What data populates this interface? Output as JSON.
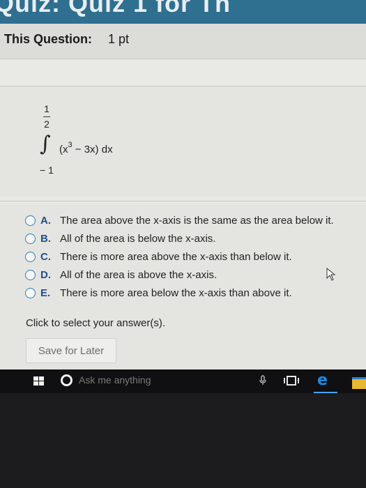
{
  "page": {
    "top_title": "Quiz: Quiz 1 for Th"
  },
  "header": {
    "question_label": "This Question:",
    "points": "1 pt"
  },
  "question": {
    "integral_upper_numerator": "1",
    "integral_upper_denominator": "2",
    "integral_sign": "∫",
    "integrand_open": "(x",
    "integrand_exponent": "3",
    "integrand_rest": " − 3x) dx",
    "integral_lower": "− 1"
  },
  "options": [
    {
      "letter": "A.",
      "text": "The area above the x-axis is the same as the area below it."
    },
    {
      "letter": "B.",
      "text": "All of the area is below the x-axis."
    },
    {
      "letter": "C.",
      "text": "There is more area above the x-axis than below it."
    },
    {
      "letter": "D.",
      "text": "All of the area is above the x-axis."
    },
    {
      "letter": "E.",
      "text": "There is more area below the x-axis than above it."
    }
  ],
  "instruction": "Click to select your answer(s).",
  "save_button": "Save for Later",
  "taskbar": {
    "search_placeholder": "Ask me anything",
    "icons": [
      "windows-start-icon",
      "cortana-icon",
      "microphone-icon",
      "task-view-icon",
      "edge-browser-icon",
      "file-explorer-icon"
    ]
  },
  "colors": {
    "option_letter": "#1f4f8c",
    "radio_border": "#2e7db6",
    "title_strip": "#2f6f8f",
    "edge": "#1e88e5"
  }
}
